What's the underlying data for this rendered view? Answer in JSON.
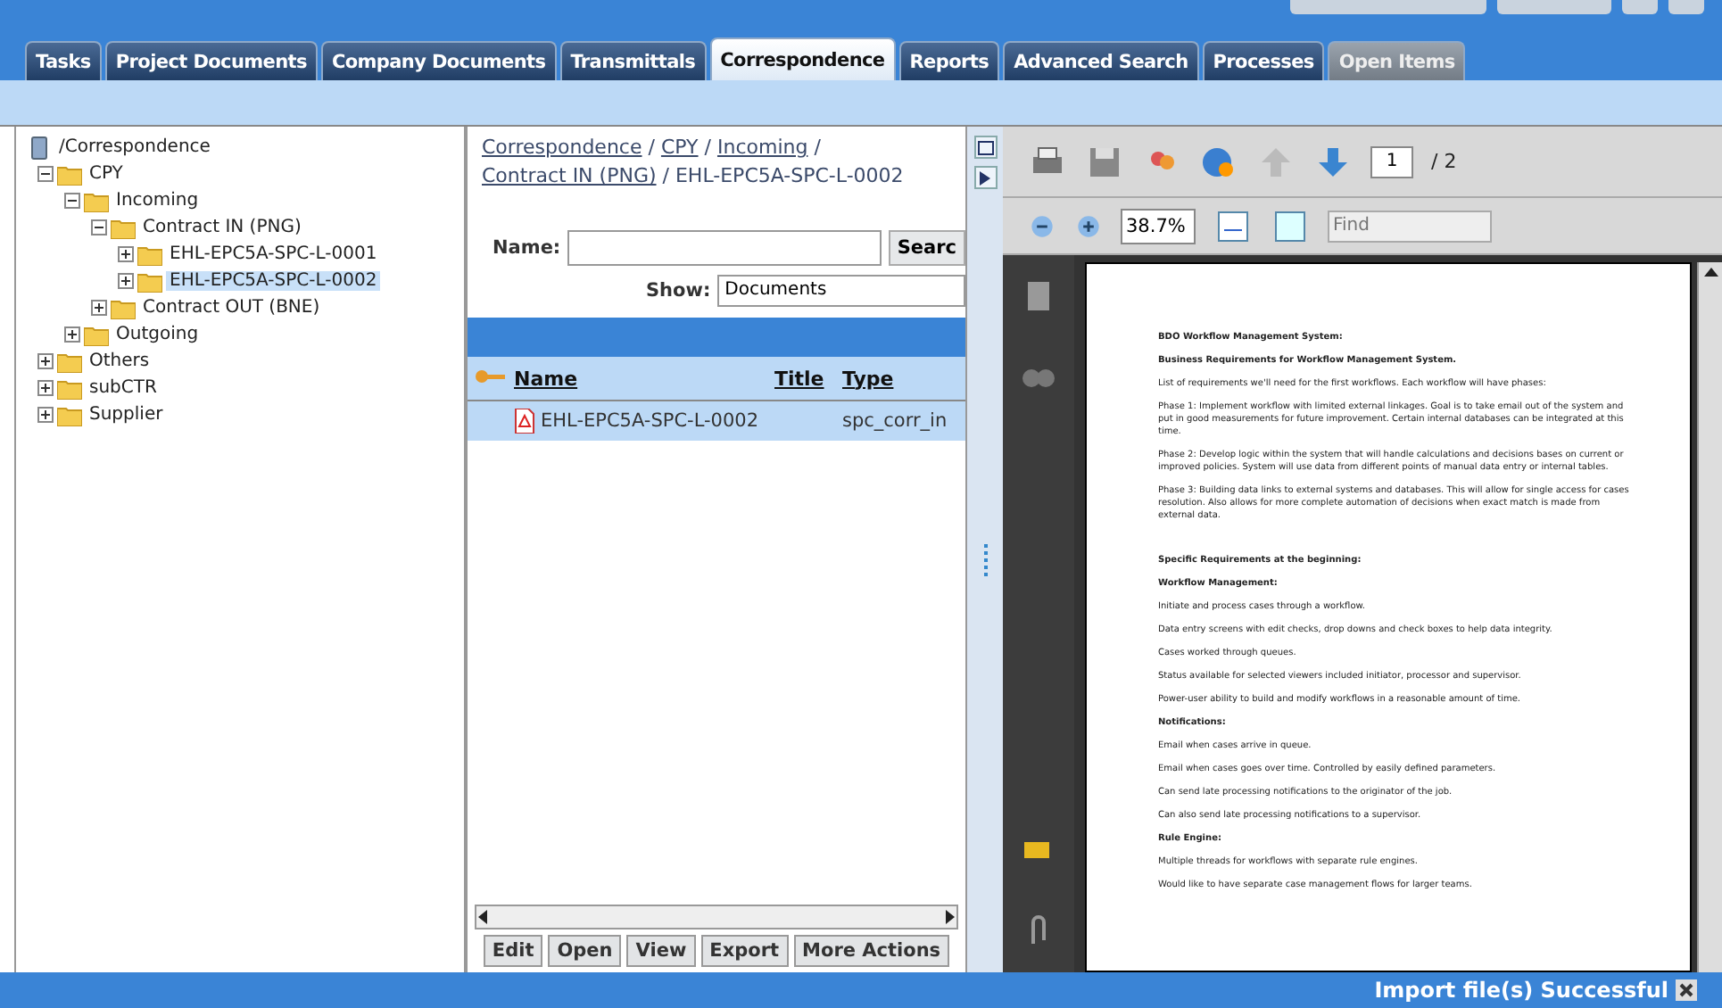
{
  "tabs": [
    {
      "label": "Tasks",
      "selected": false,
      "disabled": false
    },
    {
      "label": "Project Documents",
      "selected": false,
      "disabled": false
    },
    {
      "label": "Company Documents",
      "selected": false,
      "disabled": false
    },
    {
      "label": "Transmittals",
      "selected": false,
      "disabled": false
    },
    {
      "label": "Correspondence",
      "selected": true,
      "disabled": false
    },
    {
      "label": "Reports",
      "selected": false,
      "disabled": false
    },
    {
      "label": "Advanced Search",
      "selected": false,
      "disabled": false
    },
    {
      "label": "Processes",
      "selected": false,
      "disabled": false
    },
    {
      "label": "Open Items",
      "selected": false,
      "disabled": true
    }
  ],
  "tree": {
    "root": "/Correspondence",
    "children": [
      {
        "label": "CPY",
        "expanded": true,
        "selected": false,
        "children": [
          {
            "label": "Incoming",
            "expanded": true,
            "selected": false,
            "children": [
              {
                "label": "Contract IN (PNG)",
                "expanded": true,
                "selected": false,
                "children": [
                  {
                    "label": "EHL-EPC5A-SPC-L-0001",
                    "expanded": false,
                    "selected": false
                  },
                  {
                    "label": "EHL-EPC5A-SPC-L-0002",
                    "expanded": false,
                    "selected": true
                  }
                ]
              },
              {
                "label": "Contract OUT (BNE)",
                "expanded": false,
                "selected": false
              }
            ]
          },
          {
            "label": "Outgoing",
            "expanded": false,
            "selected": false
          }
        ]
      },
      {
        "label": "Others",
        "expanded": false,
        "selected": false
      },
      {
        "label": "subCTR",
        "expanded": false,
        "selected": false
      },
      {
        "label": "Supplier",
        "expanded": false,
        "selected": false
      }
    ]
  },
  "breadcrumb": {
    "separator": "/",
    "links": [
      "Correspondence",
      "CPY",
      "Incoming",
      "Contract IN (PNG)"
    ],
    "current": "EHL-EPC5A-SPC-L-0002"
  },
  "filter": {
    "name_label": "Name:",
    "search_button": "Searc",
    "show_label": "Show:",
    "show_value": "Documents"
  },
  "table": {
    "columns": [
      "Name",
      "Title",
      "Type"
    ],
    "rows": [
      {
        "name": "EHL-EPC5A-SPC-L-0002",
        "title": "",
        "type": "spc_corr_in",
        "selected": true
      }
    ]
  },
  "actions": [
    "Edit",
    "Open",
    "View",
    "Export",
    "More Actions"
  ],
  "viewer": {
    "page": "1",
    "page_total": "/ 2",
    "zoom": "38.7%",
    "find_placeholder": "Find"
  },
  "document": [
    {
      "text": "BDO Workflow Management System:",
      "bold": true
    },
    {
      "text": "Business Requirements for Workflow Management System.",
      "bold": true
    },
    {
      "text": "List of requirements we'll need for the first workflows. Each workflow will have phases:",
      "bold": false
    },
    {
      "text": "Phase 1: Implement workflow with limited external linkages. Goal is to take email out of the system and put in good measurements for future improvement.  Certain internal databases can be integrated at this time.",
      "bold": false
    },
    {
      "text": "Phase 2: Develop logic within the system that will handle calculations and decisions bases on current or improved policies.  System will use data from different points of manual data entry or internal tables.",
      "bold": false
    },
    {
      "text": "Phase 3: Building data links to external systems and databases.  This will allow for single access for cases resolution. Also allows for more complete automation of decisions when exact match is made from external data.",
      "bold": false
    },
    {
      "text": "Specific Requirements at the beginning:",
      "bold": true
    },
    {
      "text": "Workflow Management:",
      "bold": true
    },
    {
      "text": "Initiate and process cases through a workflow.",
      "bold": false
    },
    {
      "text": "Data entry screens with edit checks, drop downs and check boxes to help data integrity.",
      "bold": false
    },
    {
      "text": "Cases worked through queues.",
      "bold": false
    },
    {
      "text": "Status available for selected viewers included initiator, processor and supervisor.",
      "bold": false
    },
    {
      "text": "Power-user ability to build and modify workflows in a reasonable amount of time.",
      "bold": false
    },
    {
      "text": "Notifications:",
      "bold": true
    },
    {
      "text": "Email when cases arrive in queue.",
      "bold": false
    },
    {
      "text": "Email when cases goes over time. Controlled by easily defined parameters.",
      "bold": false
    },
    {
      "text": "Can send late processing notifications to the originator of the job.",
      "bold": false
    },
    {
      "text": "Can also send late processing notifications to a supervisor.",
      "bold": false
    },
    {
      "text": "Rule Engine:",
      "bold": true
    },
    {
      "text": "Multiple threads for workflows with separate rule engines.",
      "bold": false
    },
    {
      "text": "Would like to have separate case management flows for larger teams.",
      "bold": false
    }
  ],
  "status": "Import file(s) Successful"
}
